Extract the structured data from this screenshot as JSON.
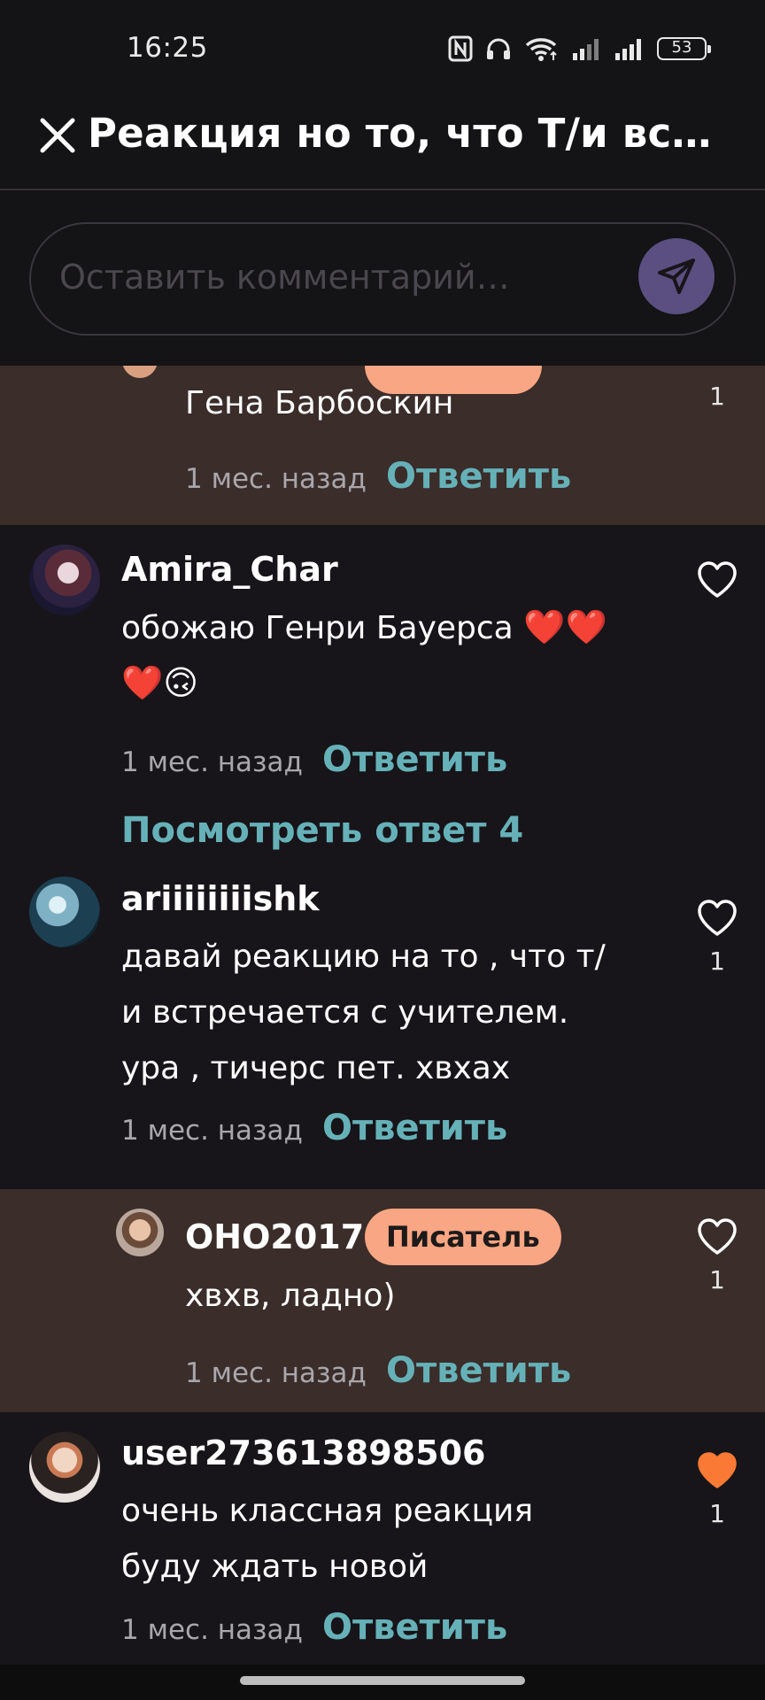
{
  "status_bar": {
    "time": "16:25",
    "battery": "53"
  },
  "header": {
    "title": "Реакция но то, что Т/и вс…"
  },
  "comment_input": {
    "placeholder": "Оставить комментарий…"
  },
  "comments": [
    {
      "text": "Гена Барбоскин",
      "time_ago": "1 мес. назад",
      "reply_label": "Ответить",
      "likes": "1"
    },
    {
      "author": "Amira_Char",
      "text_line1": "обожаю Генри Бауерса",
      "emoji_line1": "❤️❤️",
      "emoji_line2": "❤️🙃",
      "time_ago": "1 мес. назад",
      "reply_label": "Ответить",
      "view_replies": "Посмотреть ответ 4"
    },
    {
      "author": "ariiiiiiiishk",
      "text_lines": [
        "давай реакцию на то , что т/",
        "и встречается с учителем.",
        "ура , тичерс пет. хвхах"
      ],
      "time_ago": "1 мес. назад",
      "reply_label": "Ответить",
      "likes": "1"
    },
    {
      "author": "OHO2017",
      "badge": "Писатель",
      "text": "хвхв, ладно)",
      "time_ago": "1 мес. назад",
      "reply_label": "Ответить",
      "likes": "1"
    },
    {
      "author": "user273613898506",
      "text_lines": [
        "очень классная реакция",
        "буду ждать новой"
      ],
      "time_ago": "1 мес. назад",
      "reply_label": "Ответить",
      "likes": "1",
      "liked": true
    }
  ],
  "colors": {
    "accent_link": "#66b1b8",
    "badge_bg": "#f8a683",
    "reply_bg": "#3a2d2a",
    "liked_heart": "#fa7a35",
    "send_button": "#5a4f80"
  },
  "icons": [
    "close-icon",
    "send-icon",
    "heart-outline-icon",
    "heart-filled-icon",
    "nfc-icon",
    "headphones-icon",
    "wifi-icon",
    "signal-icon",
    "battery-icon"
  ]
}
